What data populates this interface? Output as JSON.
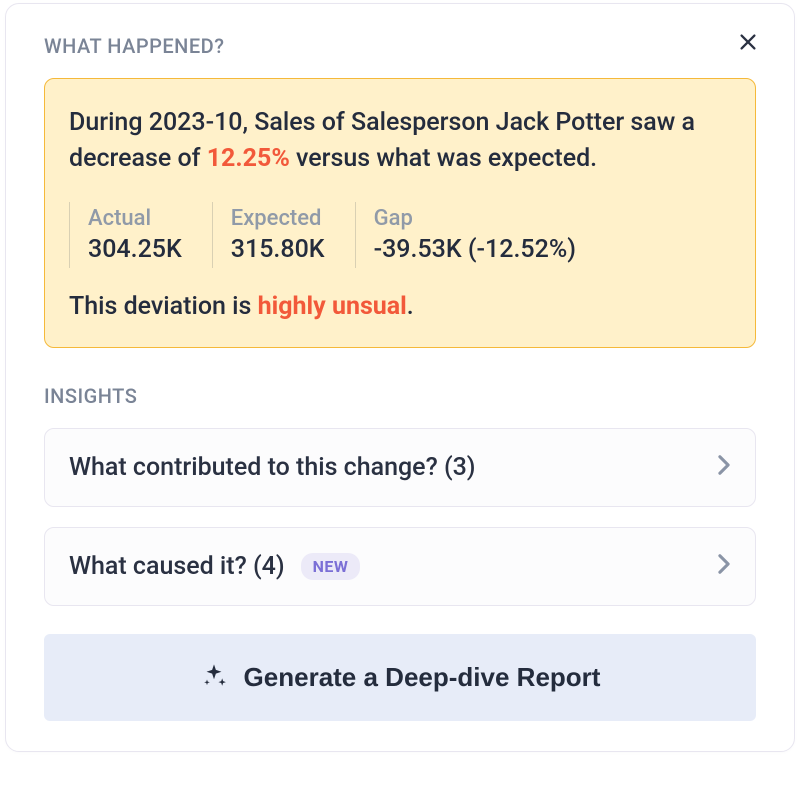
{
  "header": {
    "section_label": "WHAT HAPPENED?"
  },
  "summary": {
    "text_pre": "During 2023-10, Sales of Salesperson Jack Potter saw a decrease of ",
    "percent": "12.25%",
    "text_post": " versus what was expected.",
    "stats": {
      "actual_label": "Actual",
      "actual_value": "304.25K",
      "expected_label": "Expected",
      "expected_value": "315.80K",
      "gap_label": "Gap",
      "gap_value": "-39.53K (-12.52%)"
    },
    "deviation_pre": "This deviation is ",
    "deviation_highlight": "highly unsual",
    "deviation_post": "."
  },
  "insights": {
    "section_label": "INSIGHTS",
    "items": [
      {
        "title": "What contributed to this change? (3)",
        "badge": null
      },
      {
        "title": "What caused it? (4)",
        "badge": "NEW"
      }
    ]
  },
  "cta": {
    "label": "Generate a Deep-dive Report"
  }
}
